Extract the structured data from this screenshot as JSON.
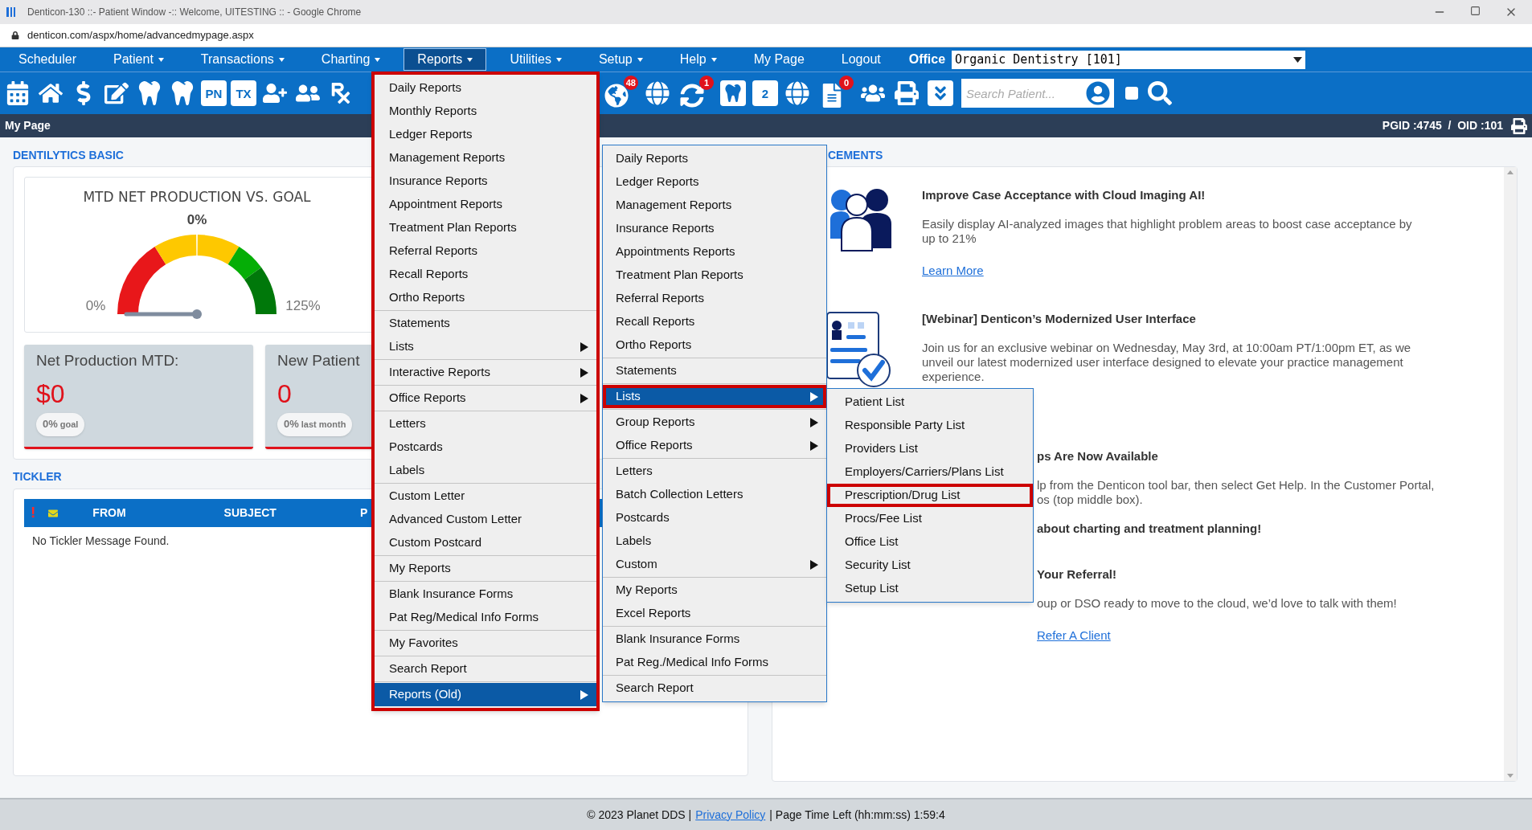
{
  "window": {
    "title": "Denticon-130 ::- Patient Window -:: Welcome, UITESTING :: - Google Chrome",
    "url": "denticon.com/aspx/home/advancedmypage.aspx"
  },
  "nav": {
    "items": [
      {
        "label": "Scheduler",
        "dropdown": false,
        "selected": false
      },
      {
        "label": "Patient",
        "dropdown": true,
        "selected": false
      },
      {
        "label": "Transactions",
        "dropdown": true,
        "selected": false
      },
      {
        "label": "Charting",
        "dropdown": true,
        "selected": false
      },
      {
        "label": "Reports",
        "dropdown": true,
        "selected": true
      },
      {
        "label": "Utilities",
        "dropdown": true,
        "selected": false
      },
      {
        "label": "Setup",
        "dropdown": true,
        "selected": false
      },
      {
        "label": "Help",
        "dropdown": true,
        "selected": false
      },
      {
        "label": "My Page",
        "dropdown": false,
        "selected": false
      },
      {
        "label": "Logout",
        "dropdown": false,
        "selected": false
      }
    ],
    "office_label": "Office",
    "office_value": "Organic Dentistry [101]"
  },
  "toolbar": {
    "tools_left": [
      {
        "kind": "calendar"
      },
      {
        "kind": "home"
      },
      {
        "kind": "dollar"
      },
      {
        "kind": "edit"
      },
      {
        "kind": "tooth"
      },
      {
        "kind": "implant"
      },
      {
        "kind": "label",
        "label": "PN"
      },
      {
        "kind": "label",
        "label": "TX"
      },
      {
        "kind": "useradd"
      },
      {
        "kind": "usersadd"
      },
      {
        "kind": "rx"
      }
    ],
    "tools_right": [
      {
        "kind": "globeuser",
        "badge": "48"
      },
      {
        "kind": "globe"
      },
      {
        "kind": "sync",
        "badge": "1"
      },
      {
        "kind": "toothbox"
      },
      {
        "kind": "label",
        "label": "2"
      },
      {
        "kind": "globecursor"
      },
      {
        "kind": "doc",
        "badge": "0"
      },
      {
        "kind": "people"
      },
      {
        "kind": "print"
      },
      {
        "kind": "chevrons"
      }
    ],
    "search": {
      "placeholder": "Search Patient..."
    },
    "checkbox": {
      "checked": false
    }
  },
  "page_bar": {
    "title": "My Page",
    "ids": "PGID :4745  /  OID :101"
  },
  "dentilytics": {
    "heading": "DENTILYTICS BASIC",
    "gauge": {
      "title": "MTD NET PRODUCTION VS. GOAL",
      "reading": "0%",
      "min": "0%",
      "max": "125%"
    },
    "stats": [
      {
        "label": "Net Production MTD:",
        "value": "$0",
        "pill_value": "0%",
        "pill_label": "goal"
      },
      {
        "label": "New Patient",
        "value": "0",
        "pill_value": "0%",
        "pill_label": "last month"
      }
    ]
  },
  "tickler": {
    "heading": "TICKLER",
    "priority_mark": "!",
    "columns": [
      "FROM",
      "SUBJECT",
      "P"
    ],
    "empty_message": "No Tickler Message Found."
  },
  "announcements": {
    "heading": "CEMENTS",
    "items": [
      {
        "kind": "people",
        "title": "Improve Case Acceptance with Cloud Imaging AI!",
        "lines": [
          "Easily display AI-analyzed images that highlight problem areas to boost case acceptance by",
          "up to 21%"
        ],
        "link": "Learn More"
      },
      {
        "kind": "form",
        "title": "[Webinar] Denticon’s Modernized User Interface",
        "lines": [
          "Join us for an exclusive webinar on Wednesday, May 3rd, at 10:00am PT/1:00pm ET, as we",
          "unveil our latest modernized user interface designed to elevate your practice management",
          "experience."
        ]
      },
      {
        "kind": "partial",
        "title": "ps Are Now Available",
        "lines": [
          "lp from the Denticon tool bar, then select Get Help. In the Customer Portal,",
          "os (top middle box)."
        ]
      },
      {
        "kind": "partial",
        "title": "about charting and treatment planning!"
      },
      {
        "kind": "partial",
        "title": "Your Referral!",
        "lines": [
          "oup or DSO ready to move to the cloud, we’d love to talk with them!"
        ],
        "link": "Refer A Client"
      }
    ]
  },
  "footer": {
    "copyright": "© 2023 Planet DDS |",
    "link": "Privacy Policy",
    "time_left": "| Page Time Left (hh:mm:ss) 1:59:4"
  },
  "menus": [
    {
      "outlined": true,
      "groups": [
        [
          {
            "label": "Daily Reports",
            "submenu": false,
            "selected": false,
            "outlined": false
          },
          {
            "label": "Monthly Reports",
            "submenu": false,
            "selected": false,
            "outlined": false
          },
          {
            "label": "Ledger Reports",
            "submenu": false,
            "selected": false,
            "outlined": false
          },
          {
            "label": "Management Reports",
            "submenu": false,
            "selected": false,
            "outlined": false
          },
          {
            "label": "Insurance Reports",
            "submenu": false,
            "selected": false,
            "outlined": false
          },
          {
            "label": "Appointment Reports",
            "submenu": false,
            "selected": false,
            "outlined": false
          },
          {
            "label": "Treatment Plan Reports",
            "submenu": false,
            "selected": false,
            "outlined": false
          },
          {
            "label": "Referral Reports",
            "submenu": false,
            "selected": false,
            "outlined": false
          },
          {
            "label": "Recall Reports",
            "submenu": false,
            "selected": false,
            "outlined": false
          },
          {
            "label": "Ortho Reports",
            "submenu": false,
            "selected": false,
            "outlined": false
          }
        ],
        [
          {
            "label": "Statements",
            "submenu": false,
            "selected": false,
            "outlined": false
          },
          {
            "label": "Lists",
            "submenu": true,
            "selected": false,
            "outlined": false
          }
        ],
        [
          {
            "label": "Interactive Reports",
            "submenu": true,
            "selected": false,
            "outlined": false
          }
        ],
        [
          {
            "label": "Office Reports",
            "submenu": true,
            "selected": false,
            "outlined": false
          }
        ],
        [
          {
            "label": "Letters",
            "submenu": false,
            "selected": false,
            "outlined": false
          },
          {
            "label": "Postcards",
            "submenu": false,
            "selected": false,
            "outlined": false
          },
          {
            "label": "Labels",
            "submenu": false,
            "selected": false,
            "outlined": false
          }
        ],
        [
          {
            "label": "Custom Letter",
            "submenu": false,
            "selected": false,
            "outlined": false
          },
          {
            "label": "Advanced Custom Letter",
            "submenu": false,
            "selected": false,
            "outlined": false
          },
          {
            "label": "Custom Postcard",
            "submenu": false,
            "selected": false,
            "outlined": false
          }
        ],
        [
          {
            "label": "My Reports",
            "submenu": false,
            "selected": false,
            "outlined": false
          }
        ],
        [
          {
            "label": "Blank Insurance Forms",
            "submenu": false,
            "selected": false,
            "outlined": false
          },
          {
            "label": "Pat Reg/Medical Info Forms",
            "submenu": false,
            "selected": false,
            "outlined": false
          }
        ],
        [
          {
            "label": "My Favorites",
            "submenu": false,
            "selected": false,
            "outlined": false
          }
        ],
        [
          {
            "label": "Search Report",
            "submenu": false,
            "selected": false,
            "outlined": false
          }
        ],
        [
          {
            "label": "Reports (Old)",
            "submenu": true,
            "selected": true,
            "outlined": false
          }
        ]
      ]
    },
    {
      "outlined": false,
      "groups": [
        [
          {
            "label": "Daily Reports",
            "submenu": false,
            "selected": false,
            "outlined": false
          },
          {
            "label": "Ledger Reports",
            "submenu": false,
            "selected": false,
            "outlined": false
          },
          {
            "label": "Management Reports",
            "submenu": false,
            "selected": false,
            "outlined": false
          },
          {
            "label": "Insurance Reports",
            "submenu": false,
            "selected": false,
            "outlined": false
          },
          {
            "label": "Appointments Reports",
            "submenu": false,
            "selected": false,
            "outlined": false
          },
          {
            "label": "Treatment Plan Reports",
            "submenu": false,
            "selected": false,
            "outlined": false
          },
          {
            "label": "Referral Reports",
            "submenu": false,
            "selected": false,
            "outlined": false
          },
          {
            "label": "Recall Reports",
            "submenu": false,
            "selected": false,
            "outlined": false
          },
          {
            "label": "Ortho Reports",
            "submenu": false,
            "selected": false,
            "outlined": false
          }
        ],
        [
          {
            "label": "Statements",
            "submenu": false,
            "selected": false,
            "outlined": false
          }
        ],
        [
          {
            "label": "Lists",
            "submenu": true,
            "selected": true,
            "outlined": true
          }
        ],
        [
          {
            "label": "Group Reports",
            "submenu": true,
            "selected": false,
            "outlined": false
          },
          {
            "label": "Office Reports",
            "submenu": true,
            "selected": false,
            "outlined": false
          }
        ],
        [
          {
            "label": "Letters",
            "submenu": false,
            "selected": false,
            "outlined": false
          },
          {
            "label": "Batch Collection Letters",
            "submenu": false,
            "selected": false,
            "outlined": false
          },
          {
            "label": "Postcards",
            "submenu": false,
            "selected": false,
            "outlined": false
          },
          {
            "label": "Labels",
            "submenu": false,
            "selected": false,
            "outlined": false
          },
          {
            "label": "Custom",
            "submenu": true,
            "selected": false,
            "outlined": false
          }
        ],
        [
          {
            "label": "My Reports",
            "submenu": false,
            "selected": false,
            "outlined": false
          },
          {
            "label": "Excel Reports",
            "submenu": false,
            "selected": false,
            "outlined": false
          }
        ],
        [
          {
            "label": "Blank Insurance Forms",
            "submenu": false,
            "selected": false,
            "outlined": false
          },
          {
            "label": "Pat Reg./Medical Info Forms",
            "submenu": false,
            "selected": false,
            "outlined": false
          }
        ],
        [
          {
            "label": "Search Report",
            "submenu": false,
            "selected": false,
            "outlined": false
          }
        ]
      ]
    },
    {
      "outlined": false,
      "groups": [
        [
          {
            "label": "Patient List",
            "submenu": false,
            "selected": false,
            "outlined": false
          },
          {
            "label": "Responsible Party List",
            "submenu": false,
            "selected": false,
            "outlined": false
          },
          {
            "label": "Providers List",
            "submenu": false,
            "selected": false,
            "outlined": false
          },
          {
            "label": "Employers/Carriers/Plans List",
            "submenu": false,
            "selected": false,
            "outlined": false
          },
          {
            "label": "Prescription/Drug List",
            "submenu": false,
            "selected": false,
            "outlined": true
          },
          {
            "label": "Procs/Fee List",
            "submenu": false,
            "selected": false,
            "outlined": false
          },
          {
            "label": "Office List",
            "submenu": false,
            "selected": false,
            "outlined": false
          },
          {
            "label": "Security List",
            "submenu": false,
            "selected": false,
            "outlined": false
          },
          {
            "label": "Setup List",
            "submenu": false,
            "selected": false,
            "outlined": false
          }
        ]
      ]
    }
  ]
}
